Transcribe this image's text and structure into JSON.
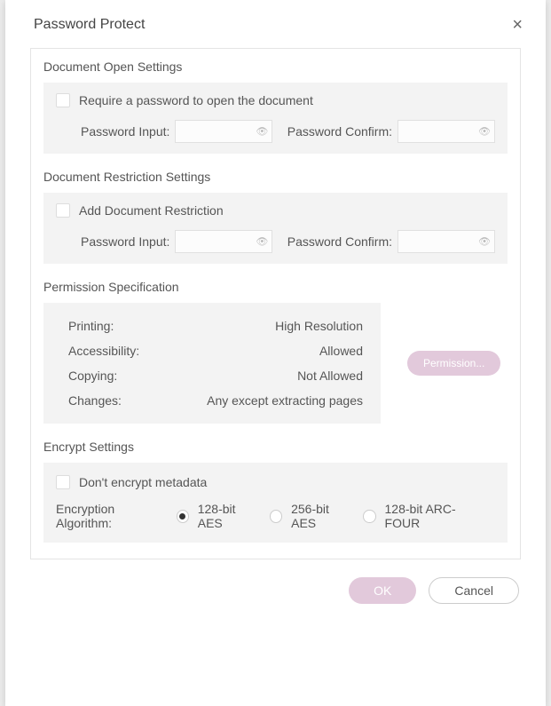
{
  "dialog": {
    "title": "Password Protect",
    "close": "×"
  },
  "openSettings": {
    "title": "Document Open Settings",
    "checkboxLabel": "Require a password to open the document",
    "passwordInputLabel": "Password Input:",
    "passwordConfirmLabel": "Password Confirm:",
    "passwordInputValue": "",
    "passwordConfirmValue": ""
  },
  "restrictionSettings": {
    "title": "Document Restriction Settings",
    "checkboxLabel": "Add Document Restriction",
    "passwordInputLabel": "Password Input:",
    "passwordConfirmLabel": "Password Confirm:",
    "passwordInputValue": "",
    "passwordConfirmValue": ""
  },
  "permissionSpec": {
    "title": "Permission Specification",
    "rows": [
      {
        "label": "Printing:",
        "value": "High Resolution"
      },
      {
        "label": "Accessibility:",
        "value": "Allowed"
      },
      {
        "label": "Copying:",
        "value": "Not Allowed"
      },
      {
        "label": "Changes:",
        "value": "Any except extracting pages"
      }
    ],
    "button": "Permission..."
  },
  "encryptSettings": {
    "title": "Encrypt Settings",
    "checkboxLabel": "Don't encrypt metadata",
    "algorithmLabel": "Encryption Algorithm:",
    "options": [
      {
        "label": "128-bit AES",
        "selected": true
      },
      {
        "label": "256-bit AES",
        "selected": false
      },
      {
        "label": "128-bit ARC-FOUR",
        "selected": false
      }
    ]
  },
  "footer": {
    "ok": "OK",
    "cancel": "Cancel"
  }
}
